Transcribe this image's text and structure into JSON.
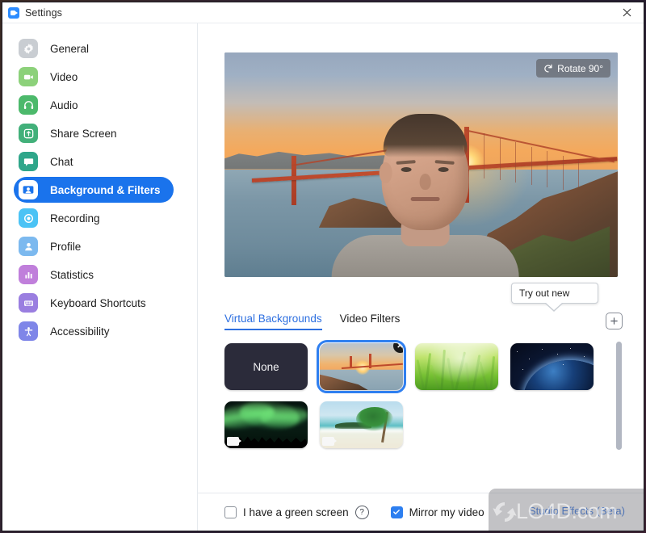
{
  "window": {
    "title": "Settings",
    "app_icon": "zoom-video-icon",
    "close_label": "×"
  },
  "sidebar": {
    "items": [
      {
        "label": "General",
        "icon": "gear-icon",
        "color": "#c9cdd2",
        "active": false
      },
      {
        "label": "Video",
        "icon": "camera-icon",
        "color": "#8cd17a",
        "active": false
      },
      {
        "label": "Audio",
        "icon": "headphones-icon",
        "color": "#4cb96b",
        "active": false
      },
      {
        "label": "Share Screen",
        "icon": "upload-icon",
        "color": "#42b07a",
        "active": false
      },
      {
        "label": "Chat",
        "icon": "chat-icon",
        "color": "#2aa municipal",
        "active": false
      },
      {
        "label": "Background & Filters",
        "icon": "person-card-icon",
        "color": "#1a73ec",
        "active": true
      },
      {
        "label": "Recording",
        "icon": "record-icon",
        "color": "#4bc3f5",
        "active": false
      },
      {
        "label": "Profile",
        "icon": "avatar-icon",
        "color": "#7cb9ef",
        "active": false
      },
      {
        "label": "Statistics",
        "icon": "bar-chart-icon",
        "color": "#c07fdb",
        "active": false
      },
      {
        "label": "Keyboard Shortcuts",
        "icon": "keyboard-icon",
        "color": "#9a7ee0",
        "active": false
      },
      {
        "label": "Accessibility",
        "icon": "accessibility-icon",
        "color": "#7f86e8",
        "active": false
      }
    ]
  },
  "preview": {
    "rotate_label": "Rotate 90°",
    "rotate_icon": "rotate-icon",
    "scene_description": "Golden Gate Bridge at sunset virtual background with person in foreground"
  },
  "tooltip": {
    "text": "Try out new"
  },
  "tabs": {
    "items": [
      {
        "label": "Virtual Backgrounds",
        "active": true
      },
      {
        "label": "Video Filters",
        "active": false
      }
    ],
    "add_icon": "plus-icon",
    "add_label": "+"
  },
  "backgrounds": {
    "items": [
      {
        "label": "None",
        "art": "none",
        "selected": false,
        "removable": false,
        "is_video": false
      },
      {
        "label": "Golden Gate Bridge",
        "art": "bridge",
        "selected": true,
        "removable": true,
        "is_video": false
      },
      {
        "label": "Grass",
        "art": "grass",
        "selected": false,
        "removable": false,
        "is_video": false
      },
      {
        "label": "Earth from Space",
        "art": "earth",
        "selected": false,
        "removable": false,
        "is_video": false
      },
      {
        "label": "Northern Lights",
        "art": "aurora",
        "selected": false,
        "removable": false,
        "is_video": true
      },
      {
        "label": "Tropical Beach",
        "art": "beach",
        "selected": false,
        "removable": false,
        "is_video": true
      }
    ],
    "remove_icon": "close-circle-icon",
    "remove_glyph": "✕",
    "video_badge_icon": "video-camera-badge-icon"
  },
  "footer": {
    "green_screen_label": "I have a green screen",
    "green_screen_checked": false,
    "help_icon": "question-mark-icon",
    "help_glyph": "?",
    "mirror_label": "Mirror my video",
    "mirror_checked": true,
    "studio_effects_label": "Studio Effects (Beta)"
  },
  "watermark": {
    "text": "LO4D.com",
    "logo_icon": "circular-arrows-logo-icon"
  },
  "colors": {
    "accent": "#2d6fe0",
    "active_nav": "#1a73ec",
    "checkbox_on": "#2d7ff0",
    "selection_outline": "#2f7ff0"
  }
}
